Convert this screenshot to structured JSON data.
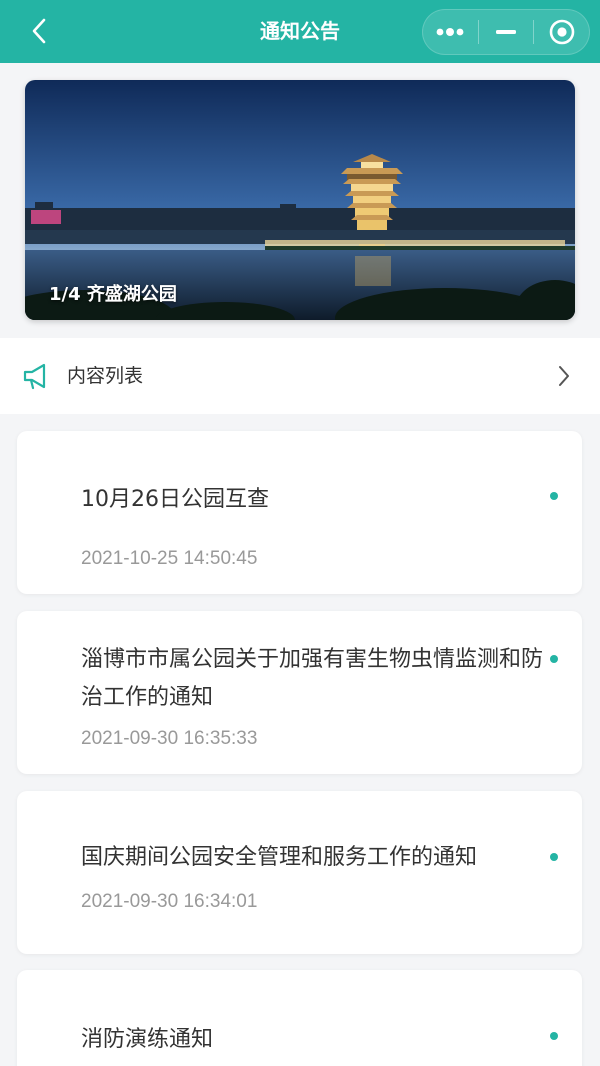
{
  "navbar": {
    "title": "通知公告",
    "back_icon": "chevron-left-icon",
    "capsule": {
      "more_icon": "more-dots-icon",
      "minimize_icon": "minimize-icon",
      "close_icon": "target-circle-icon"
    },
    "bg_color": "#24b4a4"
  },
  "banner": {
    "caption": "1/4 齐盛湖公园",
    "image": "night-lake-pagoda-photo"
  },
  "section": {
    "label": "内容列表",
    "icon": "megaphone-icon",
    "arrow_icon": "chevron-right-icon"
  },
  "notices": [
    {
      "title": "10月26日公园互查",
      "time": "2021-10-25 14:50:45"
    },
    {
      "title": "淄博市市属公园关于加强有害生物虫情监测和防治工作的通知",
      "time": "2021-09-30 16:35:33"
    },
    {
      "title": "国庆期间公园安全管理和服务工作的通知",
      "time": "2021-09-30 16:34:01"
    },
    {
      "title": "消防演练通知",
      "time": ""
    }
  ],
  "accent_color": "#24b4a4"
}
